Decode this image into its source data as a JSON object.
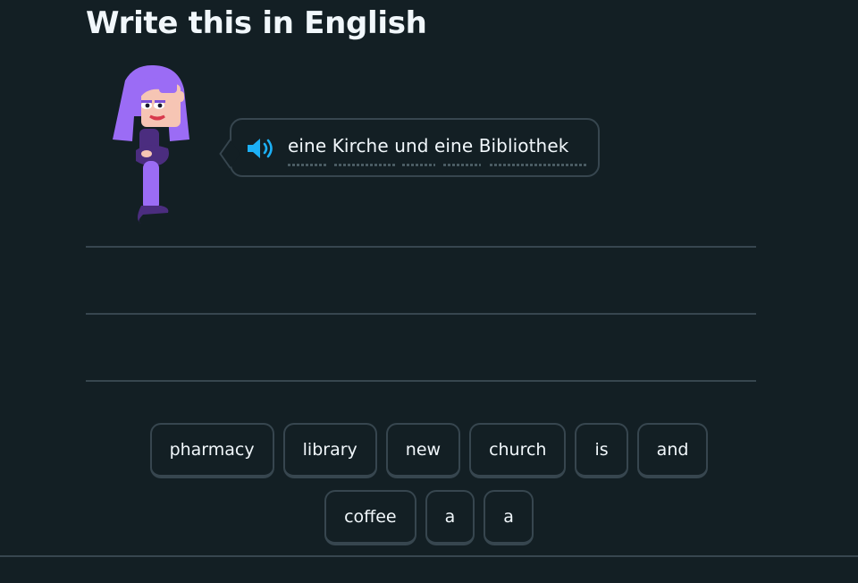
{
  "header": {
    "title": "Write this in English"
  },
  "prompt": {
    "text": "eine Kirche und eine Bibliothek",
    "speaker_icon": "speaker-icon",
    "accent_color": "#1cb0f6"
  },
  "word_bank": {
    "row1": [
      "pharmacy",
      "library",
      "new",
      "church",
      "is",
      "and"
    ],
    "row2": [
      "coffee",
      "a",
      "a"
    ]
  },
  "colors": {
    "background": "#131f24",
    "border": "#37464f",
    "text": "#f1f7fb",
    "character_hair": "#9b6cf5",
    "character_body": "#4b2d7f"
  }
}
